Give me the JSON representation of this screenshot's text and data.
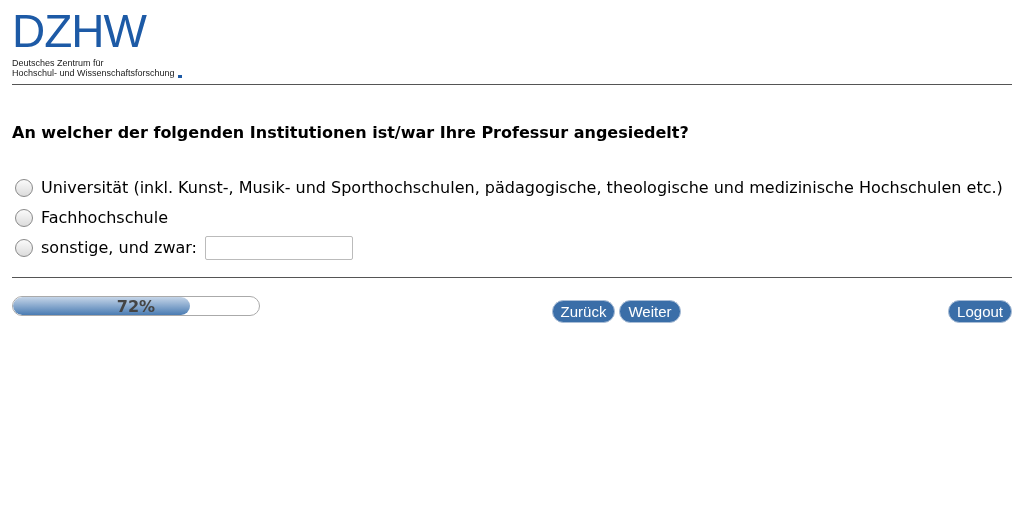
{
  "logo": {
    "wordmark": "DZHW",
    "subtitle_lines": [
      "Deutsches Zentrum für",
      "Hochschul- und Wissenschaftsforschung"
    ]
  },
  "question": {
    "text": "An welcher der folgenden Institutionen ist/war Ihre Professur angesiedelt?",
    "options": [
      {
        "kind": "plain",
        "label": "Universität (inkl. Kunst-, Musik- und Sporthochschulen, pädagogische, theologische und medizinische Hochschulen etc.)",
        "selected": false
      },
      {
        "kind": "plain",
        "label": "Fachhochschule",
        "selected": false
      },
      {
        "kind": "other",
        "label": "sonstige, und zwar:",
        "selected": false
      }
    ]
  },
  "progress": {
    "level": 0.72,
    "reading": "72%"
  },
  "nav_buttons": [
    "Zurück",
    "Weiter"
  ],
  "logout_button": "Logout"
}
